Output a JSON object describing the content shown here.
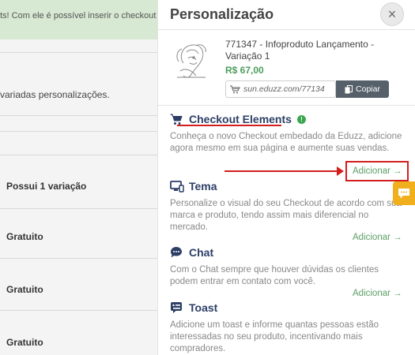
{
  "background": {
    "banner_text": "ts! Com ele é possível inserir o checkout Sun",
    "description": "variadas personalizações.",
    "rows": [
      "Possui 1 variação",
      "Gratuito",
      "Gratuito",
      "Gratuito"
    ]
  },
  "panel": {
    "title": "Personalização",
    "close_icon": "×"
  },
  "product": {
    "name": "771347 - Infoproduto Lançamento - Variação 1",
    "price": "R$ 67,00",
    "link_value": "sun.eduzz.com/77134",
    "copy_label": "Copiar"
  },
  "sections": [
    {
      "title": "Checkout Elements",
      "icon": "cart-icon",
      "badge": "!",
      "description": "Conheça o novo Checkout embedado da Eduzz, adicione agora mesmo em sua página e aumente suas vendas.",
      "add_label": "Adicionar"
    },
    {
      "title": "Tema",
      "icon": "monitor-icon",
      "description": "Personalize o visual do seu Checkout de acordo com sua marca e produto, tendo assim mais diferencial no mercado.",
      "add_label": "Adicionar"
    },
    {
      "title": "Chat",
      "icon": "chat-icon",
      "description": "Com o Chat sempre que houver dúvidas os clientes podem entrar em contato com você.",
      "add_label": "Adicionar"
    },
    {
      "title": "Toast",
      "icon": "toast-icon",
      "description": "Adicione um toast e informe quantas pessoas estão interessadas no seu produto, incentivando mais compradores."
    }
  ],
  "arrow_symbol": "→",
  "colors": {
    "accent_green": "#5b9e66",
    "title_navy": "#2c3e66",
    "highlight_red": "#d31e1e",
    "chat_tab": "#f0b01e"
  }
}
